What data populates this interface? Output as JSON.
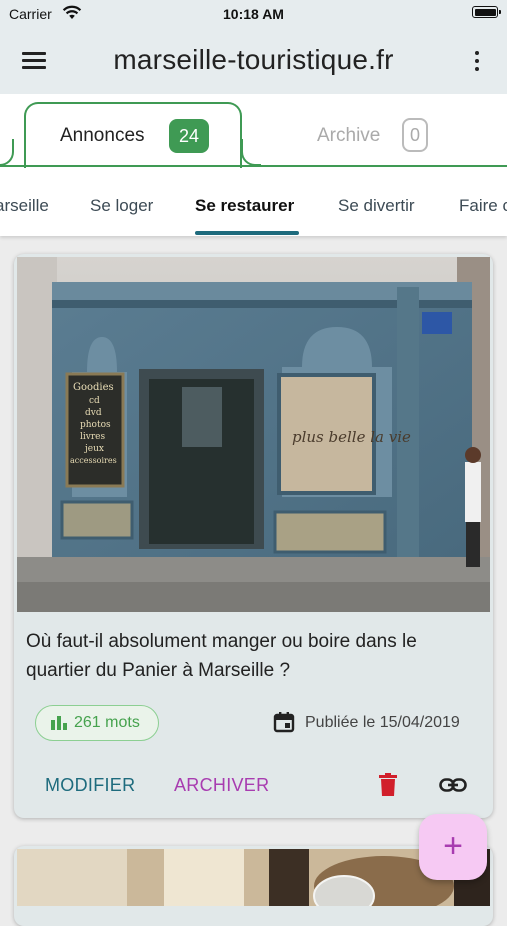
{
  "status_bar": {
    "carrier": "Carrier",
    "time": "10:18 AM"
  },
  "app_bar": {
    "title": "marseille-touristique.fr",
    "menu_icon": "hamburger-menu-icon",
    "more_icon": "more-vert-icon"
  },
  "tabs": [
    {
      "label": "Annonces",
      "count": "24",
      "active": true
    },
    {
      "label": "Archive",
      "count": "0",
      "active": false
    }
  ],
  "categories": [
    {
      "label": "arseille"
    },
    {
      "label": "Se loger"
    },
    {
      "label": "Se restaurer",
      "active": true
    },
    {
      "label": "Se divertir"
    },
    {
      "label": "Faire c"
    }
  ],
  "card": {
    "image_sign_text": "plus belle la vie",
    "image_board_text": [
      "Goodies",
      "cd",
      "dvd",
      "photos",
      "livres",
      "jeux",
      "accessoires"
    ],
    "title": "Où faut-il absolument manger ou boire dans le quartier du Panier à Marseille ?",
    "word_count": "261 mots",
    "published": "Publiée le 15/04/2019",
    "actions": {
      "edit": "MODIFIER",
      "archive": "ARCHIVER"
    }
  },
  "fab": {
    "label": "+"
  },
  "colors": {
    "accent_green": "#3f9a54",
    "teal": "#1e6b7d",
    "purple": "#a83cb0",
    "danger": "#d11f2b",
    "fab_bg": "#f6c9f3"
  }
}
